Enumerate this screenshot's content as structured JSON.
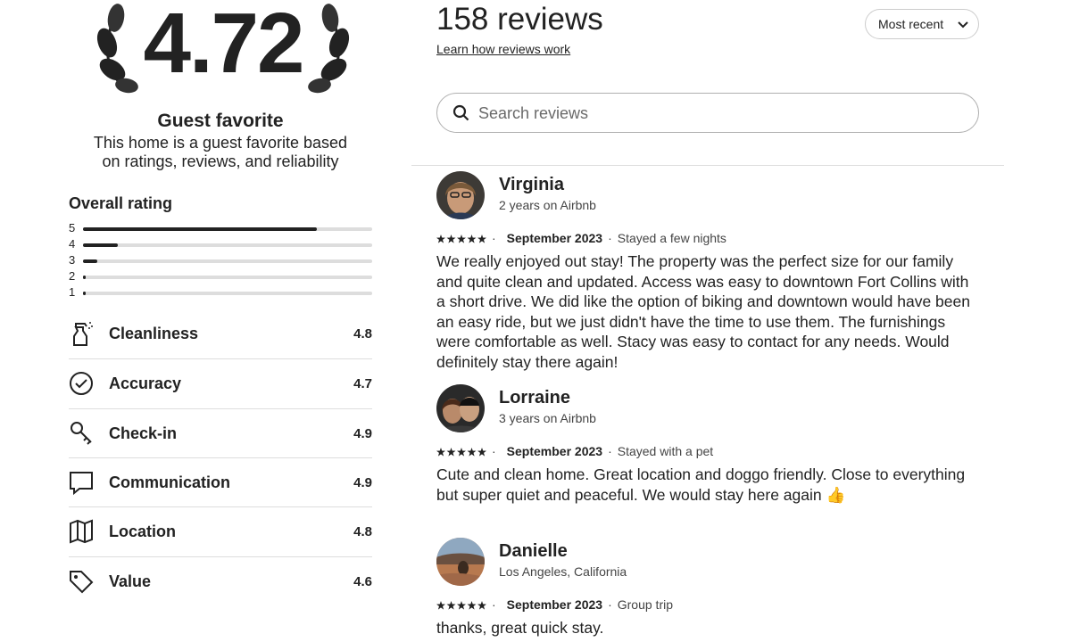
{
  "summary": {
    "score": "4.72",
    "badge_title": "Guest favorite",
    "badge_desc": "This home is a guest favorite based on ratings, reviews, and reliability",
    "overall_label": "Overall rating",
    "distribution": [
      {
        "stars": "5",
        "fraction": 0.81
      },
      {
        "stars": "4",
        "fraction": 0.12
      },
      {
        "stars": "3",
        "fraction": 0.05
      },
      {
        "stars": "2",
        "fraction": 0.01
      },
      {
        "stars": "1",
        "fraction": 0.01
      }
    ],
    "categories": [
      {
        "label": "Cleanliness",
        "score": "4.8",
        "icon": "spray-bottle-icon"
      },
      {
        "label": "Accuracy",
        "score": "4.7",
        "icon": "check-circle-icon"
      },
      {
        "label": "Check-in",
        "score": "4.9",
        "icon": "key-icon"
      },
      {
        "label": "Communication",
        "score": "4.9",
        "icon": "chat-bubble-icon"
      },
      {
        "label": "Location",
        "score": "4.8",
        "icon": "map-icon"
      },
      {
        "label": "Value",
        "score": "4.6",
        "icon": "price-tag-icon"
      }
    ]
  },
  "reviews_header": {
    "count": "158 reviews",
    "learn_link": "Learn how reviews work",
    "sort_label": "Most recent",
    "search_placeholder": "Search reviews"
  },
  "reviews": [
    {
      "name": "Virginia",
      "sub": "2 years on Airbnb",
      "date": "September 2023",
      "trip": "Stayed a few nights",
      "text": "We really enjoyed out stay! The property was the perfect size for our family and quite clean and updated. Access was easy to downtown Fort Collins with a short drive. We did like the option of biking and downtown would have been an easy ride, but we just didn't have the time to use them. The furnishings were comfortable as well. Stacy was easy to contact for any needs. Would definitely stay there again!"
    },
    {
      "name": "Lorraine",
      "sub": "3 years on Airbnb",
      "date": "September 2023",
      "trip": "Stayed with a pet",
      "text": "Cute and clean home. Great location and doggo friendly. Close to everything but super quiet and peaceful. We would stay here again 👍"
    },
    {
      "name": "Danielle",
      "sub": "Los Angeles, California",
      "date": "September 2023",
      "trip": "Group trip",
      "text": "thanks, great quick stay."
    }
  ]
}
